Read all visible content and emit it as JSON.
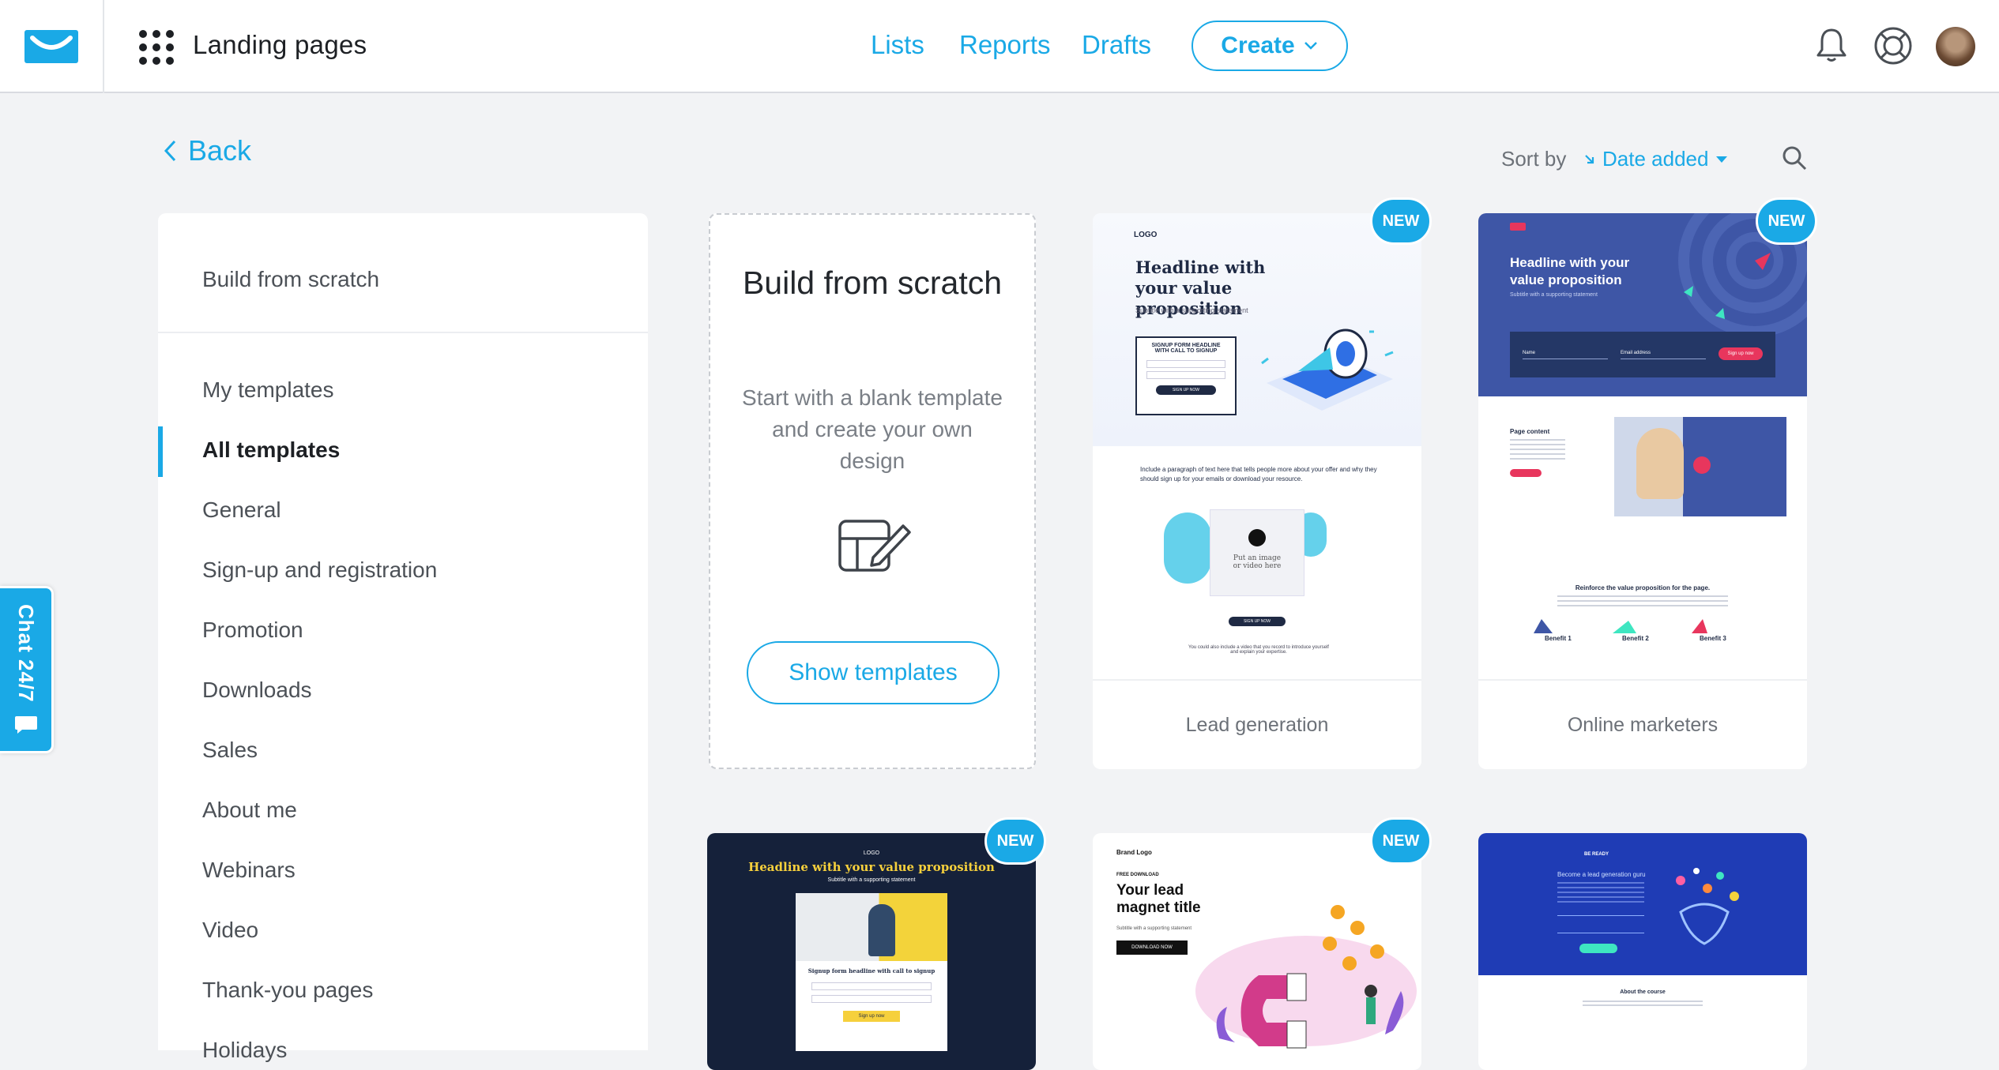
{
  "header": {
    "app_title": "Landing pages",
    "nav": [
      "Lists",
      "Reports",
      "Drafts"
    ],
    "create_label": "Create"
  },
  "back_label": "Back",
  "sort": {
    "label": "Sort by",
    "value": "Date added"
  },
  "sidebar": {
    "scratch": "Build from scratch",
    "items": [
      "My templates",
      "All templates",
      "General",
      "Sign-up and registration",
      "Promotion",
      "Downloads",
      "Sales",
      "About me",
      "Webinars",
      "Video",
      "Thank-you pages",
      "Holidays"
    ],
    "active": "All templates"
  },
  "chat_label": "Chat 24/7",
  "scratch_card": {
    "title": "Build from scratch",
    "description": "Start with a blank template and create your own design",
    "button": "Show templates"
  },
  "badge_text": "NEW",
  "templates": [
    {
      "label": "Lead generation",
      "logo": "LOGO",
      "headline": "Headline with your value proposition",
      "subtitle": "Subtitle with a supporting statement",
      "form_title": "SIGNUP FORM HEADLINE WITH CALL TO SIGNUP",
      "form_btn": "SIGN UP NOW",
      "para": "Include a paragraph of text here that tells people more about your offer and why they should sign up for your emails or download your resource.",
      "media": "Put an image or video here",
      "foot": "You could also include a video that you record to introduce yourself and explain your expertise."
    },
    {
      "label": "Online marketers",
      "headline": "Headline with your value proposition",
      "subtitle": "Subtitle with a supporting statement",
      "name_ph": "Name",
      "email_ph": "Email address",
      "btn": "Sign up now",
      "page_content": "Page content",
      "reinforce": "Reinforce the value proposition for the page.",
      "benefits": [
        "Benefit 1",
        "Benefit 2",
        "Benefit 3"
      ]
    },
    {
      "logo": "LOGO",
      "headline": "Headline with your value proposition",
      "subtitle": "Subtitle with a supporting statement",
      "form_title": "Signup form headline with call to signup",
      "btn": "Sign up now"
    },
    {
      "brand": "Brand Logo",
      "pre": "FREE DOWNLOAD",
      "title": "Your lead magnet title",
      "subtitle": "Subtitle with a supporting statement",
      "btn": "DOWNLOAD NOW"
    },
    {
      "logo": "BE READY",
      "headline": "Become a lead generation guru",
      "about": "About the course"
    }
  ]
}
